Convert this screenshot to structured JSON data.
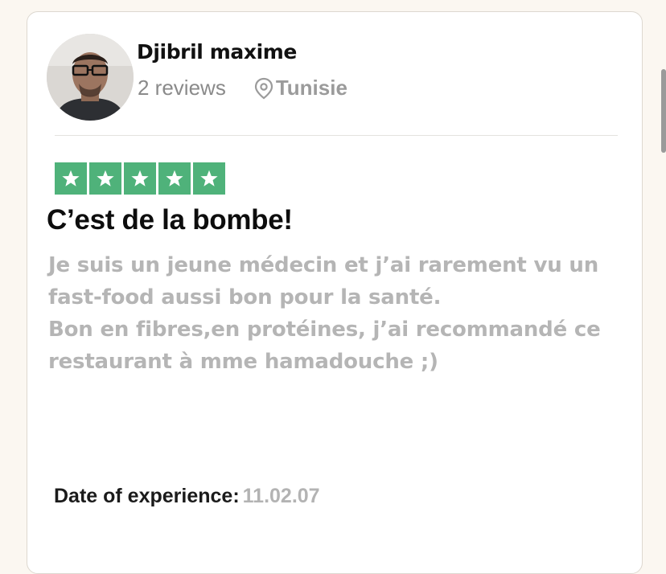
{
  "reviewer": {
    "name": "Djibril maxime",
    "reviews_count": "2 reviews",
    "location": "Tunisie"
  },
  "review": {
    "rating": 5,
    "rating_max": 5,
    "star_color": "#4fb27a",
    "title": "C’est de la bombe!",
    "body_lines": [
      "Je suis un jeune médecin et j’ai rarement vu un",
      "fast-food aussi bon pour la santé.",
      "Bon en fibres,en protéines, j’ai recommandé ce",
      "restaurant à mme hamadouche ;)"
    ]
  },
  "experience": {
    "label": "Date of experience:",
    "date": "11.02.07"
  },
  "icons": {
    "avatar": "avatar",
    "location": "location-pin-icon",
    "star": "star-icon"
  }
}
